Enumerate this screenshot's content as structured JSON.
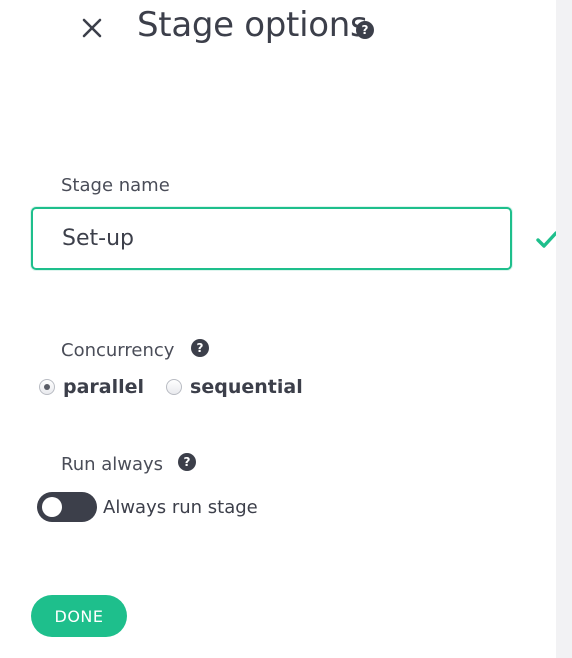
{
  "header": {
    "title": "Stage options",
    "close_icon": "close-icon",
    "help_icon": "question-circle-icon"
  },
  "stage_name": {
    "label": "Stage name",
    "value": "Set-up",
    "valid_icon": "checkmark-icon"
  },
  "concurrency": {
    "label": "Concurrency",
    "help_glyph": "?",
    "options": [
      {
        "label": "parallel",
        "checked": true
      },
      {
        "label": "sequential",
        "checked": false
      }
    ]
  },
  "run_always": {
    "label": "Run always",
    "help_glyph": "?",
    "toggle_label": "Always run stage",
    "enabled": false
  },
  "footer": {
    "done_label": "DONE"
  },
  "colors": {
    "accent": "#1ebf8c",
    "text": "#3c3f4a",
    "toggle_track": "#3c3f4a"
  }
}
